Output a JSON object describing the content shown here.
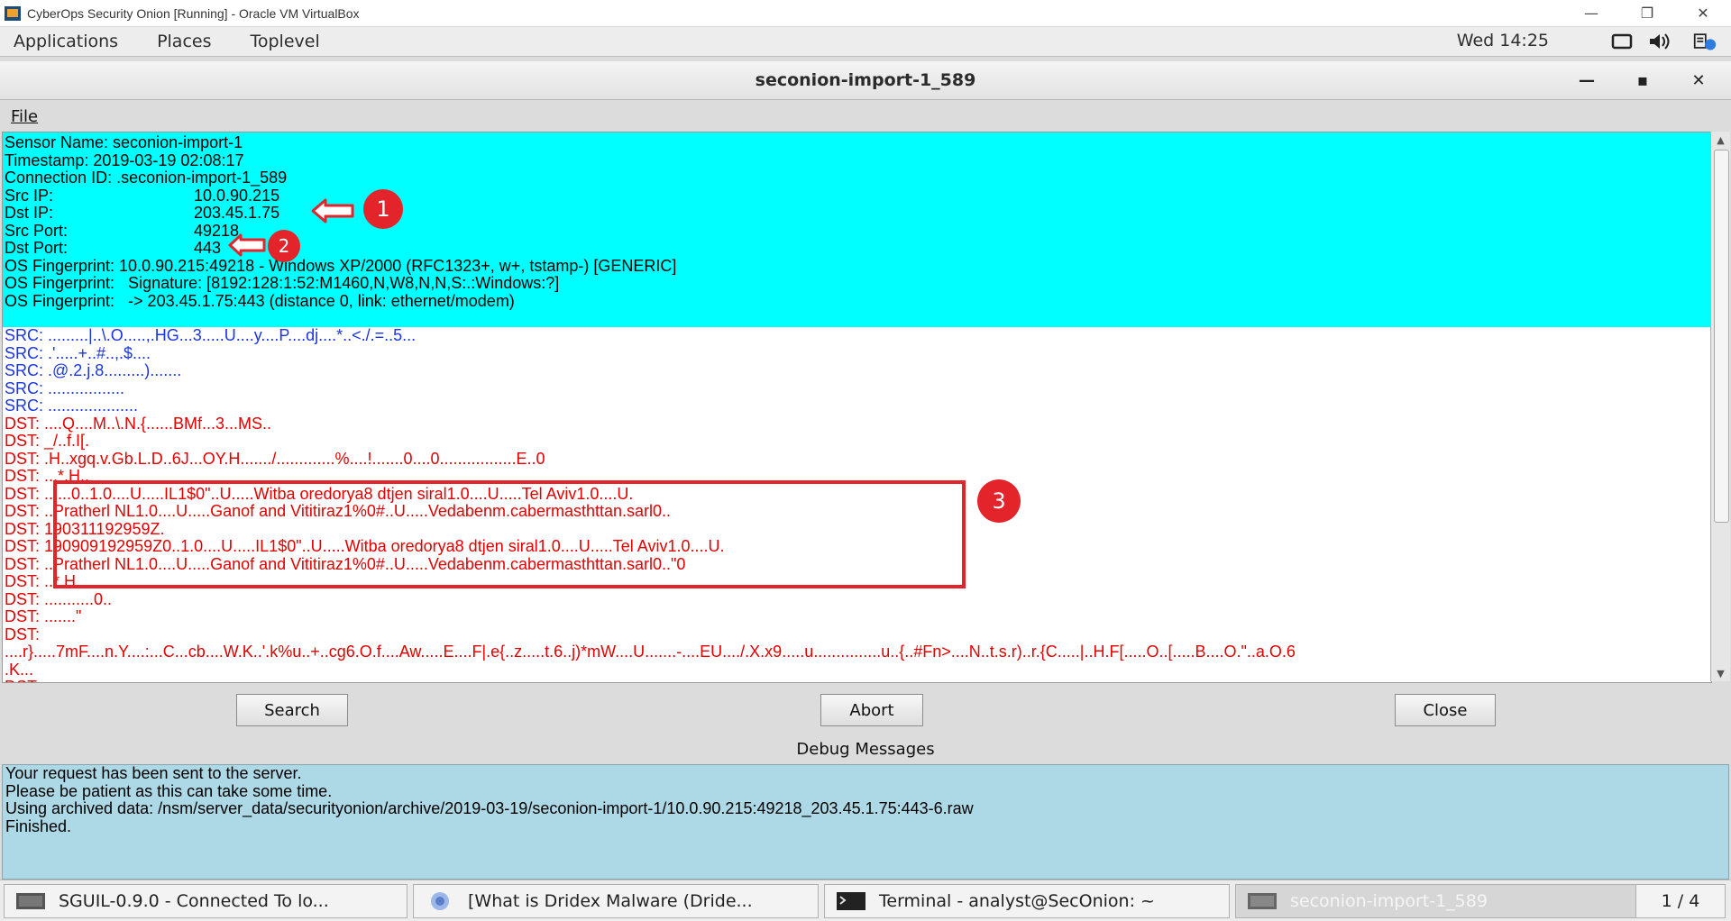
{
  "host_window": {
    "title": "CyberOps Security Onion [Running] - Oracle VM VirtualBox",
    "controls": [
      "—",
      "❐",
      "✕"
    ]
  },
  "panel": {
    "menus": [
      "Applications",
      "Places",
      "Toplevel"
    ],
    "clock": "Wed 14:25"
  },
  "window": {
    "title": "seconion-import-1_589",
    "minimize": "—",
    "maximize": "▪",
    "close": "✕"
  },
  "menubar": {
    "file": "File"
  },
  "transcript": {
    "header": {
      "sensor": "Sensor Name: seconion-import-1",
      "timestamp": "Timestamp: 2019-03-19 02:08:17",
      "connection": "Connection ID: .seconion-import-1_589",
      "src_ip_key": "Src IP:",
      "src_ip": "10.0.90.215",
      "dst_ip_key": "Dst IP:",
      "dst_ip": "203.45.1.75",
      "src_port_key": "Src Port:",
      "src_port": "49218",
      "dst_port_key": "Dst Port:",
      "dst_port": "443",
      "os_fp1": "OS Fingerprint: 10.0.90.215:49218 - Windows XP/2000 (RFC1323+, w+, tstamp-) [GENERIC]",
      "os_fp2": "OS Fingerprint:   Signature: [8192:128:1:52:M1460,N,W8,N,N,S:.:Windows:?]",
      "os_fp3": "OS Fingerprint:   -> 203.45.1.75:443 (distance 0, link: ethernet/modem)"
    },
    "lines": [
      {
        "cls": "src",
        "text": "SRC: .........|..\\.O.....,.HG...3.....U....y....P....dj....*..<./.=..5..."
      },
      {
        "cls": "src",
        "text": "SRC: .'.....+..#..,.$...."
      },
      {
        "cls": "src",
        "text": "SRC: .@.2.j.8.........)......."
      },
      {
        "cls": "src",
        "text": "SRC: ................."
      },
      {
        "cls": "src",
        "text": "SRC: ...................."
      },
      {
        "cls": "dst",
        "text": "DST: ....Q....M..\\.N.{......BMf...3...MS.."
      },
      {
        "cls": "dst",
        "text": "DST: _/..f.I[."
      },
      {
        "cls": "dst",
        "text": "DST: .H..xgq.v.Gb.L.D..6J...OY.H......./.............%....!.......0....0.................E..0"
      },
      {
        "cls": "dst",
        "text": "DST: ...*.H.."
      },
      {
        "cls": "dst",
        "text": "DST: ......0..1.0....U.....IL1$0\"..U.....Witba oredorya8 dtjen siral1.0....U.....Tel Aviv1.0....U."
      },
      {
        "cls": "dst",
        "text": "DST: ..Pratherl NL1.0....U.....Ganof and Vititiraz1%0#..U.....Vedabenm.cabermasthttan.sarl0.."
      },
      {
        "cls": "dst",
        "text": "DST: 190311192959Z."
      },
      {
        "cls": "dst",
        "text": "DST: 190909192959Z0..1.0....U.....IL1$0\"..U.....Witba oredorya8 dtjen siral1.0....U.....Tel Aviv1.0....U."
      },
      {
        "cls": "dst",
        "text": "DST: ..Pratherl NL1.0....U.....Ganof and Vititiraz1%0#..U.....Vedabenm.cabermasthttan.sarl0..\"0"
      },
      {
        "cls": "dst",
        "text": "DST: ..*.H.."
      },
      {
        "cls": "dst",
        "text": "DST: ...........0.."
      },
      {
        "cls": "dst",
        "text": "DST: .......\""
      },
      {
        "cls": "dst",
        "text": "DST:"
      },
      {
        "cls": "dst",
        "text": "....r}.....7mF....n.Y....:...C...cb....W.K..'.k%u..+..cg6.O.f....Aw.....E....F|.e{..z.....t.6..j)*mW....U.......-....EU..../.X.x9.....u...............u..{..#Fn>....N..t.s.r)..r.{C.....|..H.F[.....O..[.....B....O.\"..a.O.6"
      },
      {
        "cls": "dst",
        "text": ".K..."
      },
      {
        "cls": "dst",
        "text": "DST: ."
      }
    ]
  },
  "annotations": {
    "one": "1",
    "two": "2",
    "three": "3"
  },
  "buttons": {
    "search": "Search",
    "abort": "Abort",
    "close": "Close"
  },
  "debug": {
    "label": "Debug Messages",
    "lines": [
      "Your request has been sent to the server.",
      "Please be patient as this can take some time.",
      "Using archived data: /nsm/server_data/securityonion/archive/2019-03-19/seconion-import-1/10.0.90.215:49218_203.45.1.75:443-6.raw",
      "Finished."
    ]
  },
  "taskbar": {
    "tasks": [
      "SGUIL-0.9.0 - Connected To lo...",
      "[What is Dridex Malware (Dride...",
      "Terminal - analyst@SecOnion: ~",
      "seconion-import-1_589"
    ],
    "workspace": "1 / 4"
  },
  "colors": {
    "header_bg": "#00ffff",
    "src_text": "#1a35e8",
    "dst_text": "#e30000",
    "annotation": "#e3242b",
    "debug_bg": "#add8e6"
  }
}
